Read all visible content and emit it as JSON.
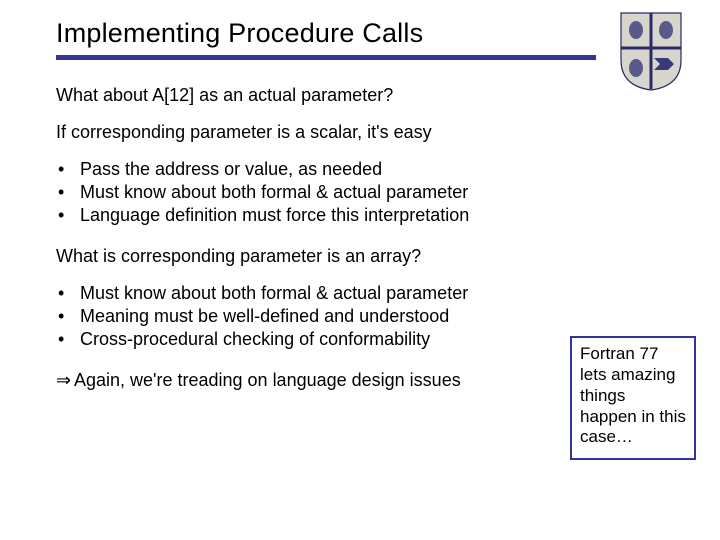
{
  "title": "Implementing Procedure Calls",
  "intro": "What about A[12] as an actual parameter?",
  "block1": {
    "lead": "If corresponding parameter is a scalar, it's easy",
    "bullets": [
      "Pass the address or value, as needed",
      "Must know about both formal & actual parameter",
      "Language definition must force this interpretation"
    ]
  },
  "block2": {
    "lead": "What is corresponding parameter is an array?",
    "bullets": [
      "Must know about both formal & actual parameter",
      "Meaning must be well-defined and understood",
      "Cross-procedural checking of conformability"
    ]
  },
  "conclusion_arrow": "⇒",
  "conclusion": "Again, we're treading on language design issues",
  "callout": "Fortran 77 lets amazing things happen in this case…"
}
